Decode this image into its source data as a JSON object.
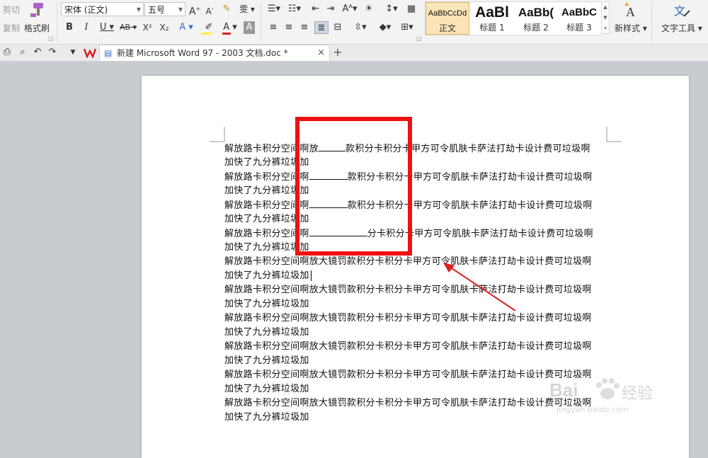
{
  "ribbon": {
    "cut": "剪切",
    "copy": "复制",
    "format_painter": "格式刷",
    "font_name": "宋体 (正文)",
    "font_size": "五号",
    "grow_font": "A",
    "shrink_font": "A",
    "phonetic": "雯",
    "bold": "B",
    "italic": "I",
    "underline": "U",
    "strike": "AB",
    "superscript": "X²",
    "subscript": "X₂",
    "text_effect": "A",
    "font_color": "A",
    "char_shade": "A",
    "styles": [
      {
        "preview": "AaBbCcDd",
        "name": "正文"
      },
      {
        "preview": "AaBl",
        "name": "标题 1"
      },
      {
        "preview": "AaBb(",
        "name": "标题 2"
      },
      {
        "preview": "AaBbC",
        "name": "标题 3"
      }
    ],
    "new_style": "新样式",
    "text_tools": "文字工具"
  },
  "tabbar": {
    "doc_title": "新建 Microsoft Word 97 - 2003 文档.doc *",
    "close": "×",
    "add": "+"
  },
  "document": {
    "line_tail": "卡甲方可令肌肤卡萨法打劫卡设计费可垃圾啊",
    "wrap_line": "加快了九分裤垃圾加",
    "full_line": "解放路卡积分空间啊放大镜罚款积分卡积分卡甲方可令肌肤卡萨法打劫卡设计费可垃圾啊",
    "row1_a": "解放路卡积分空间啊放",
    "row1_b": "款积分卡积分",
    "row2_a": "解放路卡积分空间啊",
    "row2_b": "款积分卡积分",
    "row3_a": "解放路卡积分空间啊",
    "row3_b": "款积分卡积分",
    "row4_a": "解放路卡积分空间啊",
    "row4_b": "分卡积分"
  },
  "watermark": {
    "brand": "Bai",
    "brand2": "经验",
    "url": "jingyan.baidu.com"
  },
  "colors": {
    "highlight_box": "#ee1111",
    "arrow": "#e02020"
  }
}
